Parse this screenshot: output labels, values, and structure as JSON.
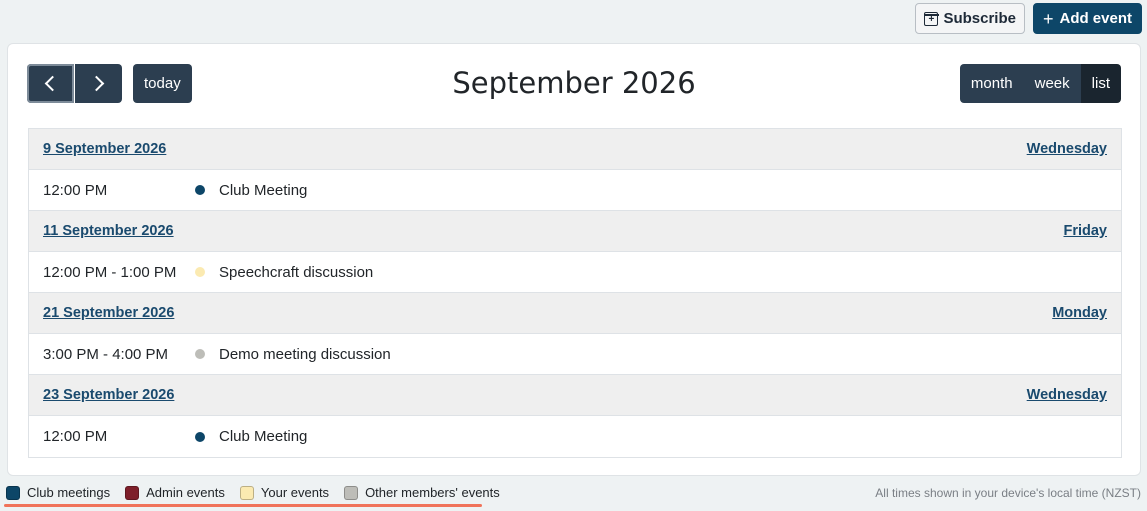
{
  "toolbar": {
    "subscribe_label": "Subscribe",
    "add_event_label": "Add event",
    "add_event_color": "#0d4668"
  },
  "calendar": {
    "title": "September 2026",
    "today_label": "today",
    "views": [
      {
        "label": "month",
        "active": false
      },
      {
        "label": "week",
        "active": false
      },
      {
        "label": "list",
        "active": true
      }
    ],
    "days": [
      {
        "date": "9 September 2026",
        "weekday": "Wednesday",
        "events": [
          {
            "time": "12:00 PM",
            "title": "Club Meeting",
            "color": "#0d4668"
          }
        ]
      },
      {
        "date": "11 September 2026",
        "weekday": "Friday",
        "events": [
          {
            "time": "12:00 PM - 1:00 PM",
            "title": "Speechcraft discussion",
            "color": "#fbeab1"
          }
        ]
      },
      {
        "date": "21 September 2026",
        "weekday": "Monday",
        "events": [
          {
            "time": "3:00 PM - 4:00 PM",
            "title": "Demo meeting discussion",
            "color": "#bdbdb8"
          }
        ]
      },
      {
        "date": "23 September 2026",
        "weekday": "Wednesday",
        "events": [
          {
            "time": "12:00 PM",
            "title": "Club Meeting",
            "color": "#0d4668"
          }
        ]
      }
    ]
  },
  "legend": {
    "items": [
      {
        "label": "Club meetings",
        "color": "#0d4668"
      },
      {
        "label": "Admin events",
        "color": "#7e1f2a"
      },
      {
        "label": "Your events",
        "color": "#fbeab1"
      },
      {
        "label": "Other members' events",
        "color": "#bdbdb8"
      }
    ],
    "underline_color": "#f0735a"
  },
  "timezone_note": "All times shown in your device's local time (NZST)"
}
